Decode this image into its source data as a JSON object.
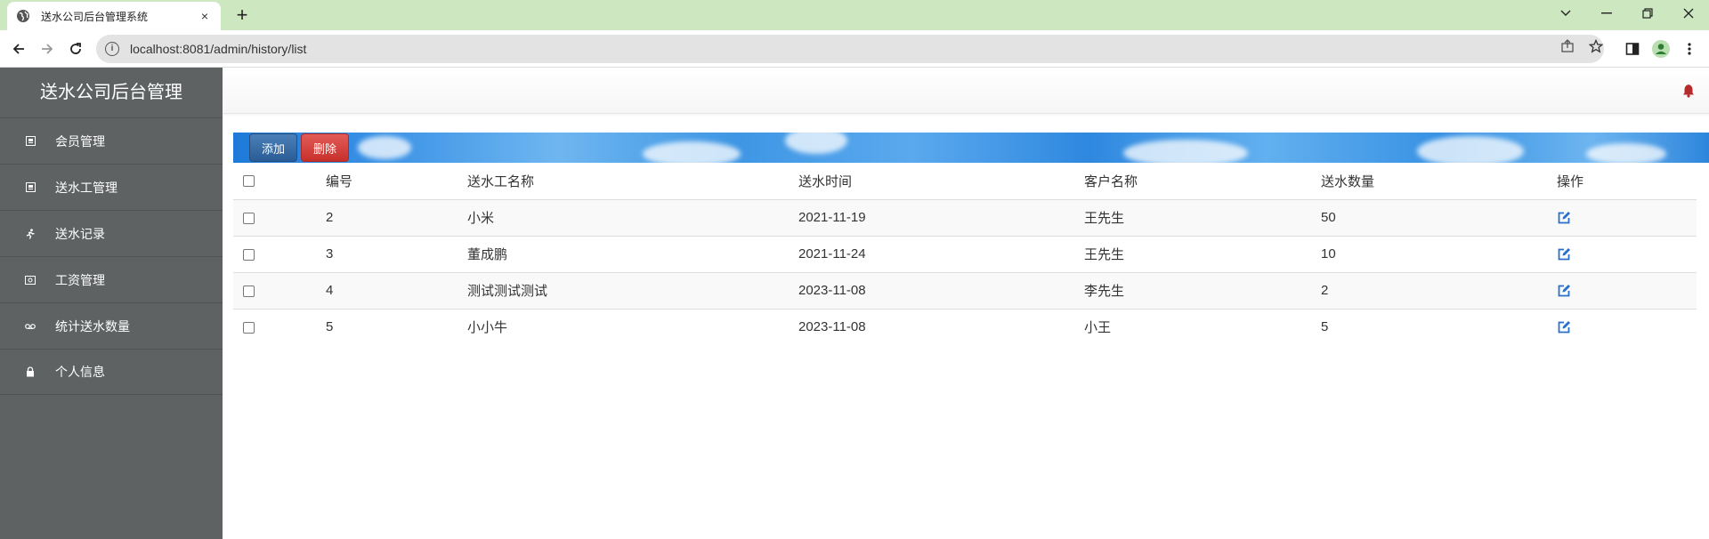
{
  "browser": {
    "tab_title": "送水公司后台管理系统",
    "tab_close": "×",
    "new_tab": "+",
    "url": "localhost:8081/admin/history/list",
    "window_controls": {
      "dropdown": "⌄",
      "minimize": "—",
      "restore": "❐",
      "close": "✕"
    }
  },
  "app": {
    "brand": "送水公司后台管理",
    "menu": [
      {
        "label": "会员管理",
        "icon": "id-card-icon"
      },
      {
        "label": "送水工管理",
        "icon": "id-card-icon"
      },
      {
        "label": "送水记录",
        "icon": "running-man-icon"
      },
      {
        "label": "工资管理",
        "icon": "money-icon"
      },
      {
        "label": "统计送水数量",
        "icon": "cassette-icon"
      },
      {
        "label": "个人信息",
        "icon": "lock-icon"
      }
    ],
    "actions": {
      "add": "添加",
      "delete": "删除"
    },
    "table": {
      "headers": [
        "编号",
        "送水工名称",
        "送水时间",
        "客户名称",
        "送水数量",
        "操作"
      ],
      "rows": [
        {
          "id": "2",
          "worker": "小米",
          "time": "2021-11-19",
          "customer": "王先生",
          "count": "50"
        },
        {
          "id": "3",
          "worker": "董成鹏",
          "time": "2021-11-24",
          "customer": "王先生",
          "count": "10"
        },
        {
          "id": "4",
          "worker": "测试测试测试",
          "time": "2023-11-08",
          "customer": "李先生",
          "count": "2"
        },
        {
          "id": "5",
          "worker": "小小牛",
          "time": "2023-11-08",
          "customer": "小王",
          "count": "5"
        }
      ]
    }
  },
  "colors": {
    "sidebar": "#5e6263",
    "tabbar": "#cde8c1",
    "add_button": "#2a5d95",
    "delete_button": "#c7302b",
    "edit_icon": "#2a6fc9",
    "bell": "#b52a2a"
  }
}
